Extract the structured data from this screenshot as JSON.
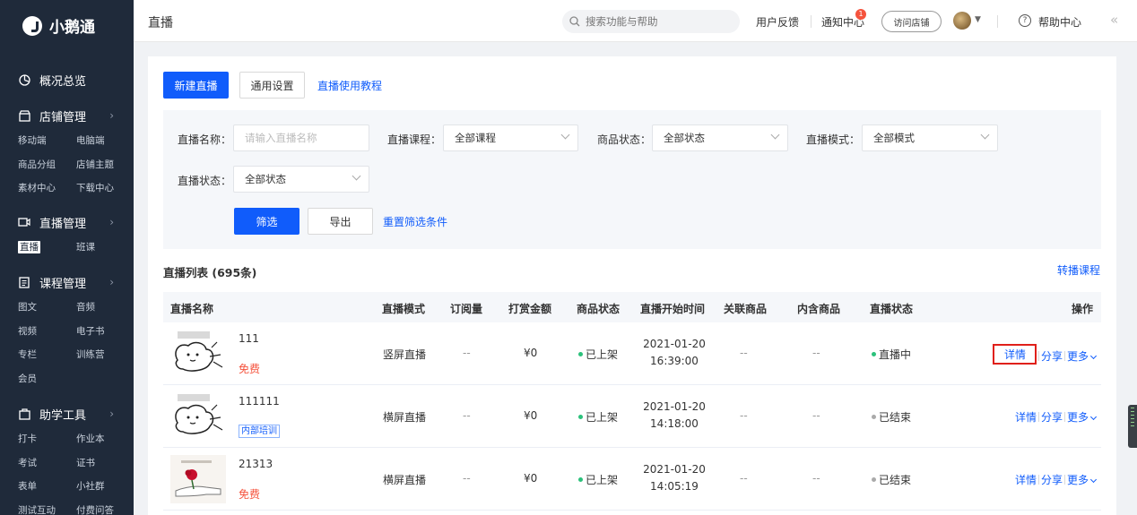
{
  "app": {
    "name": "小鹅通"
  },
  "sidebar": {
    "overview": "概况总览",
    "groups": [
      {
        "label": "店铺管理",
        "icon": "shop-icon",
        "items": [
          "移动端",
          "电脑端",
          "商品分组",
          "店铺主题",
          "素材中心",
          "下载中心"
        ]
      },
      {
        "label": "直播管理",
        "icon": "live-icon",
        "items": [
          "直播",
          "班课"
        ]
      },
      {
        "label": "课程管理",
        "icon": "course-icon",
        "items": [
          "图文",
          "音频",
          "视频",
          "电子书",
          "专栏",
          "训练营",
          "会员"
        ]
      },
      {
        "label": "助学工具",
        "icon": "tools-icon",
        "items": [
          "打卡",
          "作业本",
          "考试",
          "证书",
          "表单",
          "小社群",
          "测试互动",
          "付费问答"
        ]
      }
    ],
    "active_item": "直播"
  },
  "header": {
    "title": "直播",
    "search_placeholder": "搜索功能与帮助",
    "feedback": "用户反馈",
    "notifications": "通知中心",
    "notification_count": "1",
    "visit_store": "访问店铺",
    "help": "帮助中心"
  },
  "toolbar": {
    "new_live": "新建直播",
    "general_settings": "通用设置",
    "tutorial": "直播使用教程"
  },
  "filters": {
    "name_label": "直播名称：",
    "name_placeholder": "请输入直播名称",
    "course_label": "直播课程：",
    "course_value": "全部课程",
    "product_status_label": "商品状态：",
    "product_status_value": "全部状态",
    "mode_label": "直播模式：",
    "mode_value": "全部模式",
    "live_status_label": "直播状态：",
    "live_status_value": "全部状态",
    "filter_button": "筛选",
    "export_button": "导出",
    "reset_link": "重置筛选条件"
  },
  "list": {
    "title": "直播列表 (695条)",
    "transfer_link": "转播课程",
    "columns": [
      "直播名称",
      "直播模式",
      "订阅量",
      "打赏金额",
      "商品状态",
      "直播开始时间",
      "关联商品",
      "内含商品",
      "直播状态",
      "操作"
    ],
    "actions": {
      "detail": "详情",
      "share": "分享",
      "more": "更多"
    },
    "rows": [
      {
        "name": "111",
        "price_tag": "免费",
        "tag_type": "free",
        "mode": "竖屏直播",
        "subscriptions": "--",
        "reward": "¥0",
        "product_status": "已上架",
        "start_date": "2021-01-20",
        "start_time": "16:39:00",
        "linked": "--",
        "contained": "--",
        "live_status": "直播中",
        "status_color": "#2bc17b"
      },
      {
        "name": "111111",
        "price_tag": "内部培训",
        "tag_type": "internal",
        "mode": "横屏直播",
        "subscriptions": "--",
        "reward": "¥0",
        "product_status": "已上架",
        "start_date": "2021-01-20",
        "start_time": "14:18:00",
        "linked": "--",
        "contained": "--",
        "live_status": "已结束",
        "status_color": "#aaaaaa"
      },
      {
        "name": "21313",
        "price_tag": "免费",
        "tag_type": "free",
        "mode": "横屏直播",
        "subscriptions": "--",
        "reward": "¥0",
        "product_status": "已上架",
        "start_date": "2021-01-20",
        "start_time": "14:05:19",
        "linked": "--",
        "contained": "--",
        "live_status": "已结束",
        "status_color": "#aaaaaa"
      }
    ]
  },
  "colors": {
    "primary": "#105cfb",
    "sidebar_bg": "#1f2a3a",
    "danger": "#f5533d",
    "online": "#2bc17b"
  }
}
